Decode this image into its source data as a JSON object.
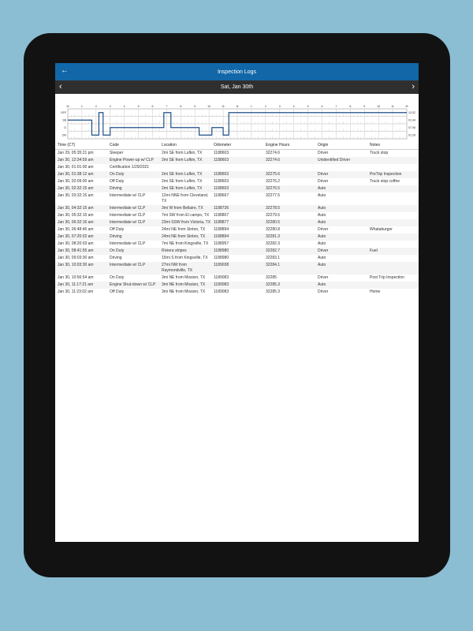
{
  "header": {
    "title": "Inspection Logs",
    "back_icon": "back-arrow-icon"
  },
  "datebar": {
    "date": "Sat, Jan 30th",
    "prev_icon": "chevron-left-icon",
    "next_icon": "chevron-right-icon"
  },
  "graph": {
    "hour_labels": [
      "M",
      "1",
      "2",
      "3",
      "4",
      "5",
      "6",
      "7",
      "8",
      "9",
      "10",
      "11",
      "N",
      "1",
      "2",
      "3",
      "4",
      "5",
      "6",
      "7",
      "8",
      "9",
      "10",
      "11",
      "M"
    ],
    "row_labels": [
      "OFF",
      "SB",
      "D",
      "ON"
    ],
    "totals": [
      "13:32",
      "01:44",
      "07:36",
      "01:28"
    ],
    "status_changes": [
      {
        "hour": 0.0,
        "status": "SB"
      },
      {
        "hour": 1.7,
        "status": "ON"
      },
      {
        "hour": 2.2,
        "status": "OFF"
      },
      {
        "hour": 2.5,
        "status": "ON"
      },
      {
        "hour": 3.0,
        "status": "D"
      },
      {
        "hour": 6.8,
        "status": "OFF"
      },
      {
        "hour": 7.3,
        "status": "D"
      },
      {
        "hour": 9.3,
        "status": "ON"
      },
      {
        "hour": 10.2,
        "status": "D"
      },
      {
        "hour": 11.0,
        "status": "ON"
      },
      {
        "hour": 11.4,
        "status": "OFF"
      }
    ],
    "line_color": "#1f4e8a"
  },
  "table": {
    "columns": [
      "Time (CT)",
      "Code",
      "Location",
      "Odometer",
      "Engine Hours",
      "Origin",
      "Notes"
    ],
    "rows": [
      [
        "Jan 29, 05:35:21 pm",
        "Sleeper",
        "2mi SE from Lufkin, TX",
        "1188603",
        "32274.6",
        "Driver",
        "Truck stop"
      ],
      [
        "Jan 30, 12:34:59 am",
        "Engine Power-up w/ CLP",
        "2mi SE from Lufkin, TX",
        "1188603",
        "32274.6",
        "Unidentified Driver",
        ""
      ],
      [
        "Jan 30, 01:01:00 am",
        "Certification 1/29/2021",
        "",
        "",
        "",
        "",
        ""
      ],
      [
        "Jan 30, 01:38:12 am",
        "On Duty",
        "2mi SE from Lufkin, TX",
        "1188603",
        "32275.6",
        "Driver",
        "PreTrip Inspection"
      ],
      [
        "Jan 30, 02:09:00 am",
        "Off Duty",
        "2mi SE from Lufkin, TX",
        "1188603",
        "32276.2",
        "Driver",
        "Truck stop coffee"
      ],
      [
        "Jan 30, 02:32:15 am",
        "Driving",
        "2mi SE from Lufkin, TX",
        "1188603",
        "32276.5",
        "Auto",
        ""
      ],
      [
        "Jan 30, 03:32:15 am",
        "Intermediate w/ CLP",
        "12mi NNE from Cleveland, TX",
        "1188667",
        "32277.5",
        "Auto",
        ""
      ],
      [
        "Jan 30, 04:32:15 am",
        "Intermediate w/ CLP",
        "3mi W from Bellaire, TX",
        "1188736",
        "32278.5",
        "Auto",
        ""
      ],
      [
        "Jan 30, 05:32:15 am",
        "Intermediate w/ CLP",
        "7mi SW from El campo, TX",
        "1188807",
        "32279.5",
        "Auto",
        ""
      ],
      [
        "Jan 30, 06:32:16 am",
        "Intermediate w/ CLP",
        "23mi SSW from Victoria, TX",
        "1188877",
        "32280.5",
        "Auto",
        ""
      ],
      [
        "Jan 30, 06:48:46 am",
        "Off Duty",
        "24mi NE from Sinton, TX",
        "1188894",
        "32280.8",
        "Driver",
        "Whataburger"
      ],
      [
        "Jan 30, 07:20:02 am",
        "Driving",
        "24mi NE from Sinton, TX",
        "1188894",
        "32281.3",
        "Auto",
        ""
      ],
      [
        "Jan 30, 08:20:03 am",
        "Intermediate w/ CLP",
        "7mi NE from Kingsville, TX",
        "1188957",
        "32282.3",
        "Auto",
        ""
      ],
      [
        "Jan 30, 08:41:55 am",
        "On Duty",
        "Riviera stripes",
        "1188980",
        "32282.7",
        "Driver",
        "Fuel"
      ],
      [
        "Jan 30, 09:03:30 am",
        "Driving",
        "15mi S from Kingsville, TX",
        "1188980",
        "32283.1",
        "Auto",
        ""
      ],
      [
        "Jan 30, 10:03:30 am",
        "Intermediate w/ CLP",
        "27mi NW from Raymondville, TX",
        "1189038",
        "32284.1",
        "Auto",
        ""
      ],
      [
        "Jan 30, 10:56:54 am",
        "On Duty",
        "3mi NE from Mission, TX",
        "1189083",
        "32285",
        "Driver",
        "Post Trip Inspection"
      ],
      [
        "Jan 30, 11:17:21 am",
        "Engine Shut-down w/ CLP",
        "3mi NE from Mission, TX",
        "1189083",
        "32285.3",
        "Auto",
        ""
      ],
      [
        "Jan 30, 11:23:02 am",
        "Off Duty",
        "3mi NE from Mission, TX",
        "1189083",
        "32285.3",
        "Driver",
        "Home"
      ]
    ]
  }
}
